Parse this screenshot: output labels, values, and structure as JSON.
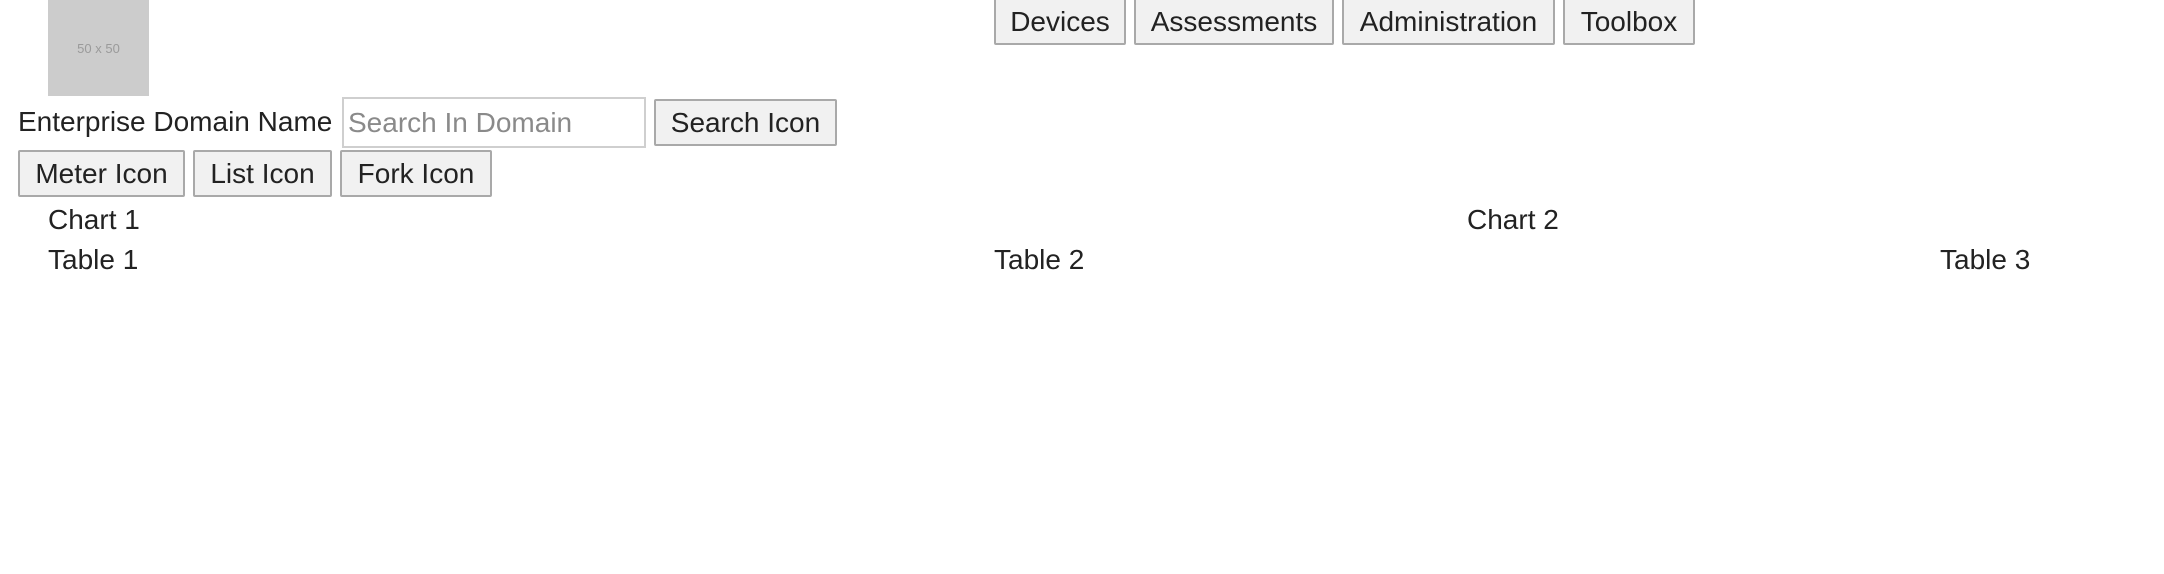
{
  "logo": {
    "placeholder_text": "50 x 50"
  },
  "nav": {
    "devices": "Devices",
    "assessments": "Assessments",
    "administration": "Administration",
    "toolbox": "Toolbox"
  },
  "domain": {
    "label": "Enterprise Domain Name",
    "placeholder": "Search In Domain",
    "search_button": "Search Icon"
  },
  "views": {
    "meter": "Meter Icon",
    "list": "List Icon",
    "fork": "Fork Icon"
  },
  "charts": [
    "Chart 1",
    "Chart 2"
  ],
  "tables": [
    "Table 1",
    "Table 2",
    "Table 3"
  ]
}
